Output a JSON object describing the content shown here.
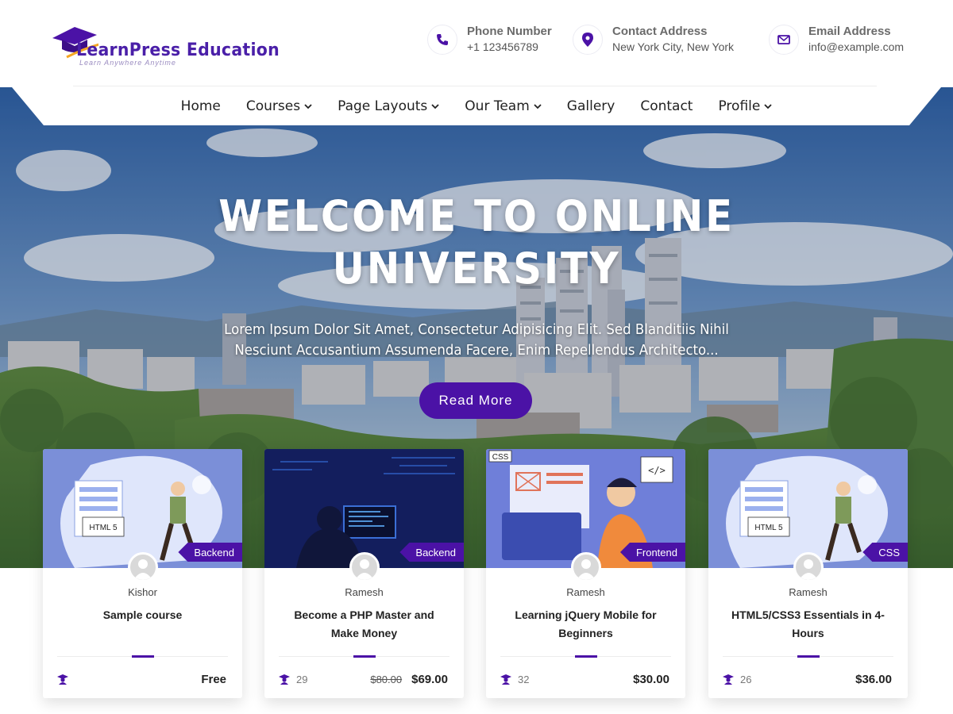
{
  "brand": {
    "name": "LearnPress Education",
    "tagline": "Learn Anywhere Anytime",
    "colors": {
      "primary": "#4b12a6",
      "accent": "#f5a623",
      "text": "#222222"
    }
  },
  "contacts": [
    {
      "label": "Phone Number",
      "value": "+1 123456789",
      "icon": "phone-icon"
    },
    {
      "label": "Contact Address",
      "value": "New York City, New York",
      "icon": "map-pin-icon"
    },
    {
      "label": "Email Address",
      "value": "info@example.com",
      "icon": "envelope-icon"
    }
  ],
  "nav": {
    "items": [
      {
        "label": "Home",
        "dropdown": false
      },
      {
        "label": "Courses",
        "dropdown": true
      },
      {
        "label": "Page Layouts",
        "dropdown": true
      },
      {
        "label": "Our Team",
        "dropdown": true
      },
      {
        "label": "Gallery",
        "dropdown": false
      },
      {
        "label": "Contact",
        "dropdown": false
      },
      {
        "label": "Profile",
        "dropdown": true
      }
    ]
  },
  "hero": {
    "title": "WELCOME TO ONLINE UNIVERSITY",
    "text": "Lorem Ipsum Dolor Sit Amet, Consectetur Adipisicing Elit. Sed Blanditiis Nihil Nesciunt Accusantium Assumenda Facere, Enim Repellendus Architecto...",
    "button": "Read More"
  },
  "courses": [
    {
      "category": "Backend",
      "author": "Kishor",
      "title": "Sample course",
      "students": "",
      "old_price": "",
      "price": "Free",
      "image": "illustration-html5"
    },
    {
      "category": "Backend",
      "author": "Ramesh",
      "title": "Become a PHP Master and Make Money",
      "students": "29",
      "old_price": "$80.00",
      "price": "$69.00",
      "image": "photo-coder-night"
    },
    {
      "category": "Frontend",
      "author": "Ramesh",
      "title": "Learning jQuery Mobile for Beginners",
      "students": "32",
      "old_price": "",
      "price": "$30.00",
      "image": "illustration-css-developer"
    },
    {
      "category": "CSS",
      "author": "Ramesh",
      "title": "HTML5/CSS3 Essentials in 4-Hours",
      "students": "26",
      "old_price": "",
      "price": "$36.00",
      "image": "illustration-html5"
    }
  ],
  "illustration_labels": {
    "html5": "HTML 5",
    "css": "CSS"
  }
}
